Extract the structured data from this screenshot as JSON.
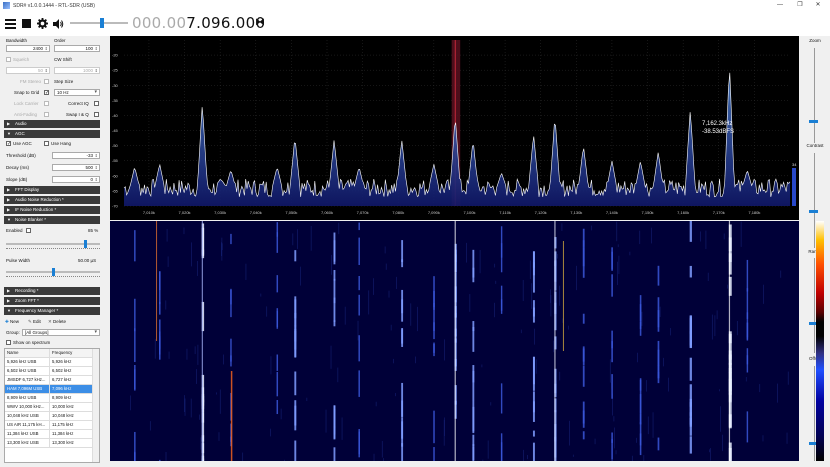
{
  "window": {
    "title": "SDR# v1.0.0.1444 - RTL-SDR (USB)",
    "controls": [
      "—",
      "❐",
      "✕"
    ]
  },
  "toolbar": {
    "icons": [
      "menu-icon",
      "stop-icon",
      "gear-icon",
      "speaker-icon"
    ],
    "frequency_inactive": "000.00",
    "frequency_active": "7.096.000",
    "swap_glyph": "⧓"
  },
  "radio": {
    "bandwidth_label": "Bandwidth",
    "bandwidth_value": "2400",
    "order_label": "Order",
    "order_value": "100",
    "squelch_label": "Squelch",
    "squelch_value": "50",
    "cw_shift_label": "CW Shift",
    "cw_shift_value": "1000",
    "fm_stereo_label": "FM Stereo",
    "step_size_label": "Step Size",
    "snap_to_grid_label": "Snap to Grid",
    "step_size_value": "10 Hz",
    "lock_carrier_label": "Lock Carrier",
    "correct_iq_label": "Correct IQ",
    "anti_fading_label": "Anti-Fading",
    "swap_iq_label": "Swap I & Q"
  },
  "sections": {
    "audio": "Audio",
    "agc": "AGC",
    "fft_display": "FFT Display",
    "audio_noise_reduction": "Audio Noise Reduction *",
    "if_noise_reduction": "IF Noise Reduction *",
    "noise_blanker": "Noise Blanker *",
    "recording": "Recording *",
    "zoom_fft": "Zoom FFT *",
    "frequency_manager": "Frequency Manager *"
  },
  "agc": {
    "use_agc_label": "Use AGC",
    "use_hang_label": "Use Hang",
    "threshold_label": "Threshold (dB)",
    "threshold_value": "-33",
    "decay_label": "Decay (ms)",
    "decay_value": "500",
    "slope_label": "Slope (dB)",
    "slope_value": "0"
  },
  "noise_blanker": {
    "enabled_label": "Enabled",
    "threshold_percent": "85 %",
    "threshold_level": 0.85,
    "pulse_width_label": "Pulse Width",
    "pulse_width_value": "50.00 µS",
    "pulse_width_level": 0.5
  },
  "frequency_manager": {
    "new_label": "New",
    "edit_label": "Edit",
    "delete_label": "Delete",
    "group_label": "Group:",
    "group_value": "[All Groups]",
    "show_on_spectrum_label": "Show on spectrum",
    "columns": [
      "Name",
      "Frequency"
    ],
    "rows": [
      [
        "5,926 kHz USB",
        "5,926 kHz"
      ],
      [
        "6,502 kHz USB",
        "6,502 kHz"
      ],
      [
        "JMSDF 6,727 kHz...",
        "6,727 kHz"
      ],
      [
        "HAM 7,096M USB",
        "7,096 kHz"
      ],
      [
        "8,909 kHz USB",
        "8,909 kHz"
      ],
      [
        "WWV 10,000 kHz...",
        "10,000 kHz"
      ],
      [
        "10,048 kHz USB",
        "10,048 kHz"
      ],
      [
        "US AIR 11,175 kH...",
        "11,175 kHz"
      ],
      [
        "11,384 kHz USB",
        "11,384 kHz"
      ],
      [
        "13,300 kHz USB",
        "13,300 kHz"
      ]
    ],
    "selected_index": 3
  },
  "spectrum": {
    "readout_freq": "7,162.3kHz",
    "readout_level": "-38.53dBFS",
    "right_edge_label": "34",
    "colors": {
      "trace": "#ffffff",
      "fill_top": "#4a7cc8",
      "fill_bottom": "#10186a",
      "filter_band": "#5a1020",
      "center_line": "#e03040"
    }
  },
  "right_panel": {
    "zoom_label": "Zoom",
    "contrast_label": "Contrast",
    "range_label": "Range",
    "offset_label": "Offset"
  },
  "chart_data": {
    "type": "line",
    "title": "",
    "xlabel": "",
    "ylabel": "",
    "x_ticks": [
      "7,010k",
      "7,020k",
      "7,030k",
      "7,040k",
      "7,050k",
      "7,060k",
      "7,070k",
      "7,080k",
      "7,090k",
      "7,100k",
      "7,110k",
      "7,120k",
      "7,130k",
      "7,140k",
      "7,150k",
      "7,160k",
      "7,170k",
      "7,180k"
    ],
    "y_ticks": [
      "-20",
      "-25",
      "-30",
      "-35",
      "-40",
      "-45",
      "-50",
      "-55",
      "-60",
      "-65",
      "-70"
    ],
    "ylim": [
      -70,
      -15
    ],
    "xlim": [
      7003,
      7190
    ],
    "noise_floor_db": -64,
    "peaks": [
      {
        "x": 7006,
        "y": -57
      },
      {
        "x": 7013,
        "y": -56
      },
      {
        "x": 7025,
        "y": -36
      },
      {
        "x": 7033,
        "y": -58
      },
      {
        "x": 7046,
        "y": -57
      },
      {
        "x": 7051,
        "y": -47
      },
      {
        "x": 7062,
        "y": -48
      },
      {
        "x": 7069,
        "y": -57
      },
      {
        "x": 7081,
        "y": -48
      },
      {
        "x": 7090,
        "y": -56
      },
      {
        "x": 7096,
        "y": -40
      },
      {
        "x": 7101,
        "y": -48
      },
      {
        "x": 7109,
        "y": -59
      },
      {
        "x": 7118,
        "y": -46
      },
      {
        "x": 7124,
        "y": -40
      },
      {
        "x": 7132,
        "y": -50
      },
      {
        "x": 7140,
        "y": -55
      },
      {
        "x": 7148,
        "y": -55
      },
      {
        "x": 7153,
        "y": -52
      },
      {
        "x": 7162,
        "y": -38
      },
      {
        "x": 7173,
        "y": -23
      },
      {
        "x": 7178,
        "y": -58
      }
    ],
    "filter_range": [
      7095,
      7097.4
    ],
    "center_freq": 7096
  }
}
